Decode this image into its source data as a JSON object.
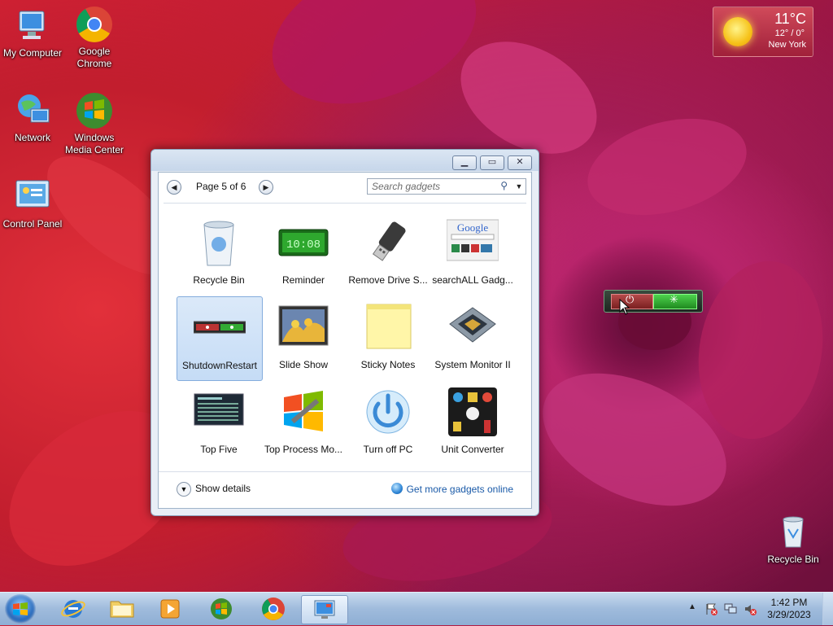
{
  "desktop": {
    "icons": [
      {
        "label": "My Computer"
      },
      {
        "label": "Google Chrome"
      },
      {
        "label": "Network"
      },
      {
        "label": "Windows Media Center"
      },
      {
        "label": "Control Panel"
      },
      {
        "label": "Recycle Bin"
      }
    ]
  },
  "weather": {
    "temp": "11°C",
    "range": "12° / 0°",
    "city": "New York"
  },
  "gadget_window": {
    "page_label": "Page 5 of 6",
    "search_placeholder": "Search gadgets",
    "gadgets": [
      {
        "label": "Recycle Bin"
      },
      {
        "label": "Reminder",
        "display": "10:08"
      },
      {
        "label": "Remove Drive S..."
      },
      {
        "label": "searchALL Gadg...",
        "logo": "Google"
      },
      {
        "label": "ShutdownRestart",
        "selected": true
      },
      {
        "label": "Slide Show"
      },
      {
        "label": "Sticky Notes"
      },
      {
        "label": "System Monitor II"
      },
      {
        "label": "Top Five"
      },
      {
        "label": "Top Process Mo..."
      },
      {
        "label": "Turn off PC"
      },
      {
        "label": "Unit Converter"
      }
    ],
    "show_details": "Show details",
    "get_more": "Get more gadgets online"
  },
  "taskbar": {
    "time": "1:42 PM",
    "date": "3/29/2023"
  },
  "colors": {
    "accent": "#1a5aa8",
    "selection": "#c5dcf6"
  }
}
